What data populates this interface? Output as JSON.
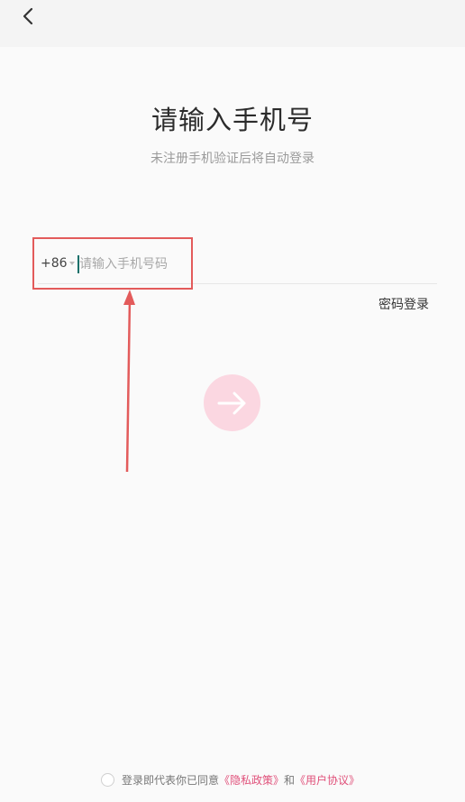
{
  "header": {
    "back_icon": "chevron-left-icon"
  },
  "main": {
    "title": "请输入手机号",
    "subtitle": "未注册手机验证后将自动登录",
    "country_code": "+86",
    "phone_placeholder": "请输入手机号码",
    "password_login_label": "密码登录",
    "submit_icon": "arrow-right-icon"
  },
  "footer": {
    "agree_text": "登录即代表你已同意",
    "privacy_link": "《隐私政策》",
    "and_text": "和",
    "user_agreement_link": "《用户协议》"
  },
  "colors": {
    "accent": "#e0507a",
    "button_bg": "#fbd7e1",
    "annotation": "#e35b5b"
  }
}
